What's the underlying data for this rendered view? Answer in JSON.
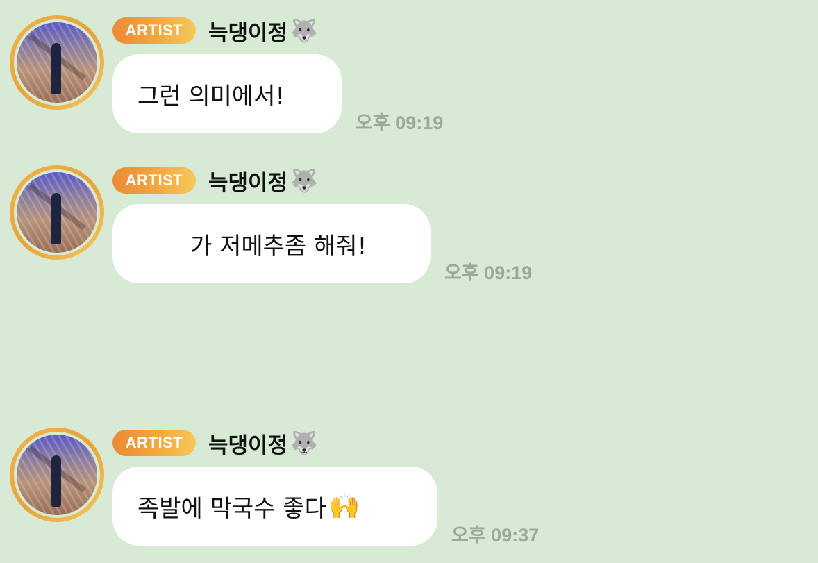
{
  "messages": [
    {
      "badge": "ARTIST",
      "sender": "늑댕이정",
      "sender_icon": "wolf-icon",
      "sender_emoji": "🐺",
      "text": "그런 의미에서!",
      "emoji": "",
      "time": "오후 09:19"
    },
    {
      "badge": "ARTIST",
      "sender": "늑댕이정",
      "sender_icon": "wolf-icon",
      "sender_emoji": "🐺",
      "text": "가 저메추좀 해줘!",
      "emoji": "",
      "time": "오후 09:19"
    },
    {
      "badge": "ARTIST",
      "sender": "늑댕이정",
      "sender_icon": "wolf-icon",
      "sender_emoji": "🐺",
      "text": "족발에 막국수 좋다",
      "emoji": "🙌",
      "emoji_icon": "raised-hands-icon",
      "time": "오후 09:37"
    }
  ],
  "colors": {
    "background": "#d6ead4",
    "bubble": "#ffffff",
    "badge_start": "#eb8a37",
    "badge_end": "#f6c85a",
    "time_text": "#9ca89a"
  }
}
